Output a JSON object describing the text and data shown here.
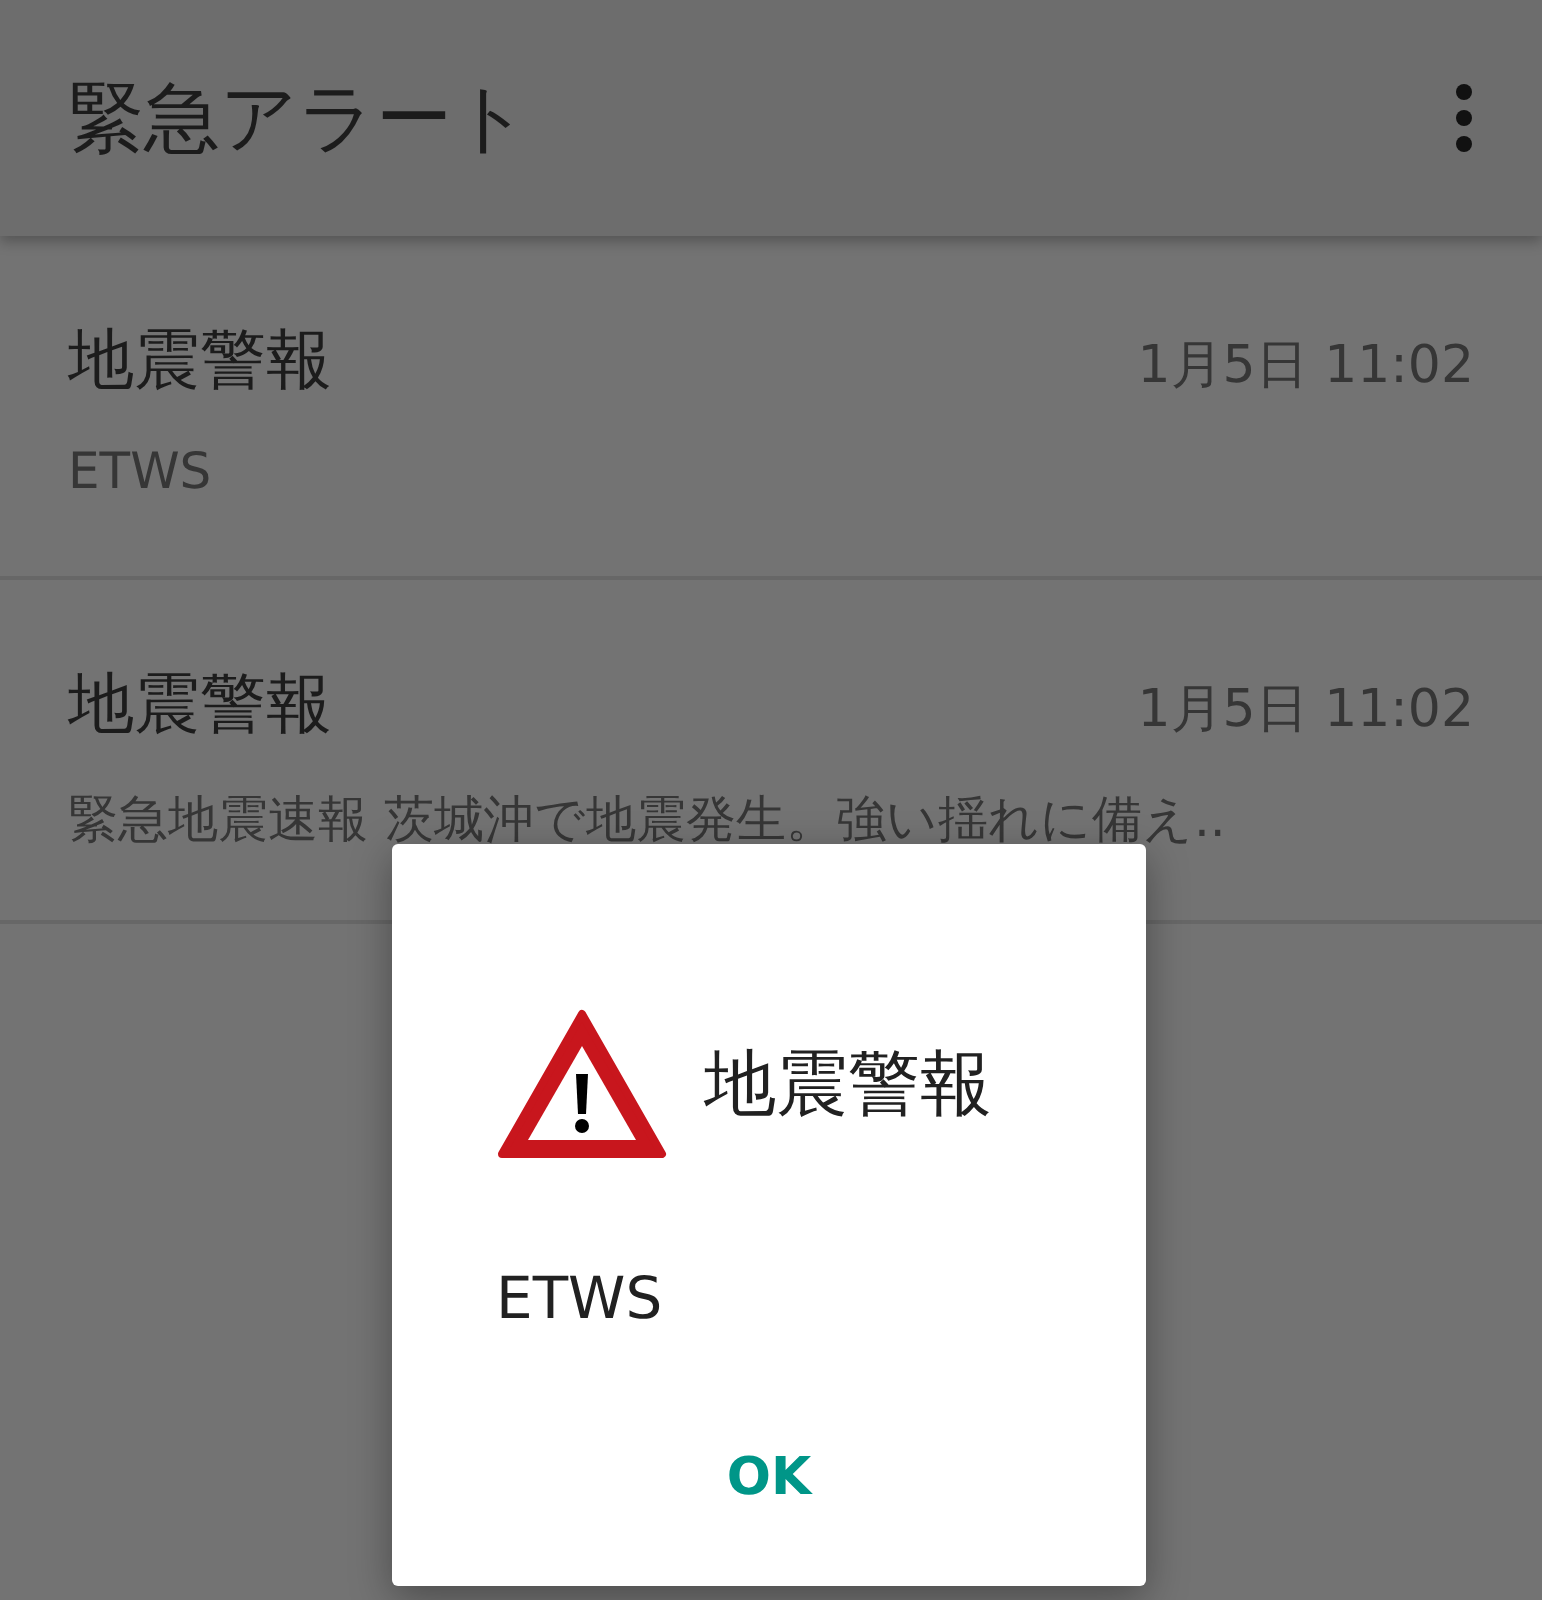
{
  "app_bar": {
    "title": "緊急アラート"
  },
  "alerts": [
    {
      "title": "地震警報",
      "time": "1月5日 11:02",
      "body": "ETWS"
    },
    {
      "title": "地震警報",
      "time": "1月5日 11:02",
      "body": "緊急地震速報 茨城沖で地震発生。強い揺れに備え.."
    }
  ],
  "dialog": {
    "title": "地震警報",
    "message": "ETWS",
    "buttons": [
      "OK"
    ]
  }
}
